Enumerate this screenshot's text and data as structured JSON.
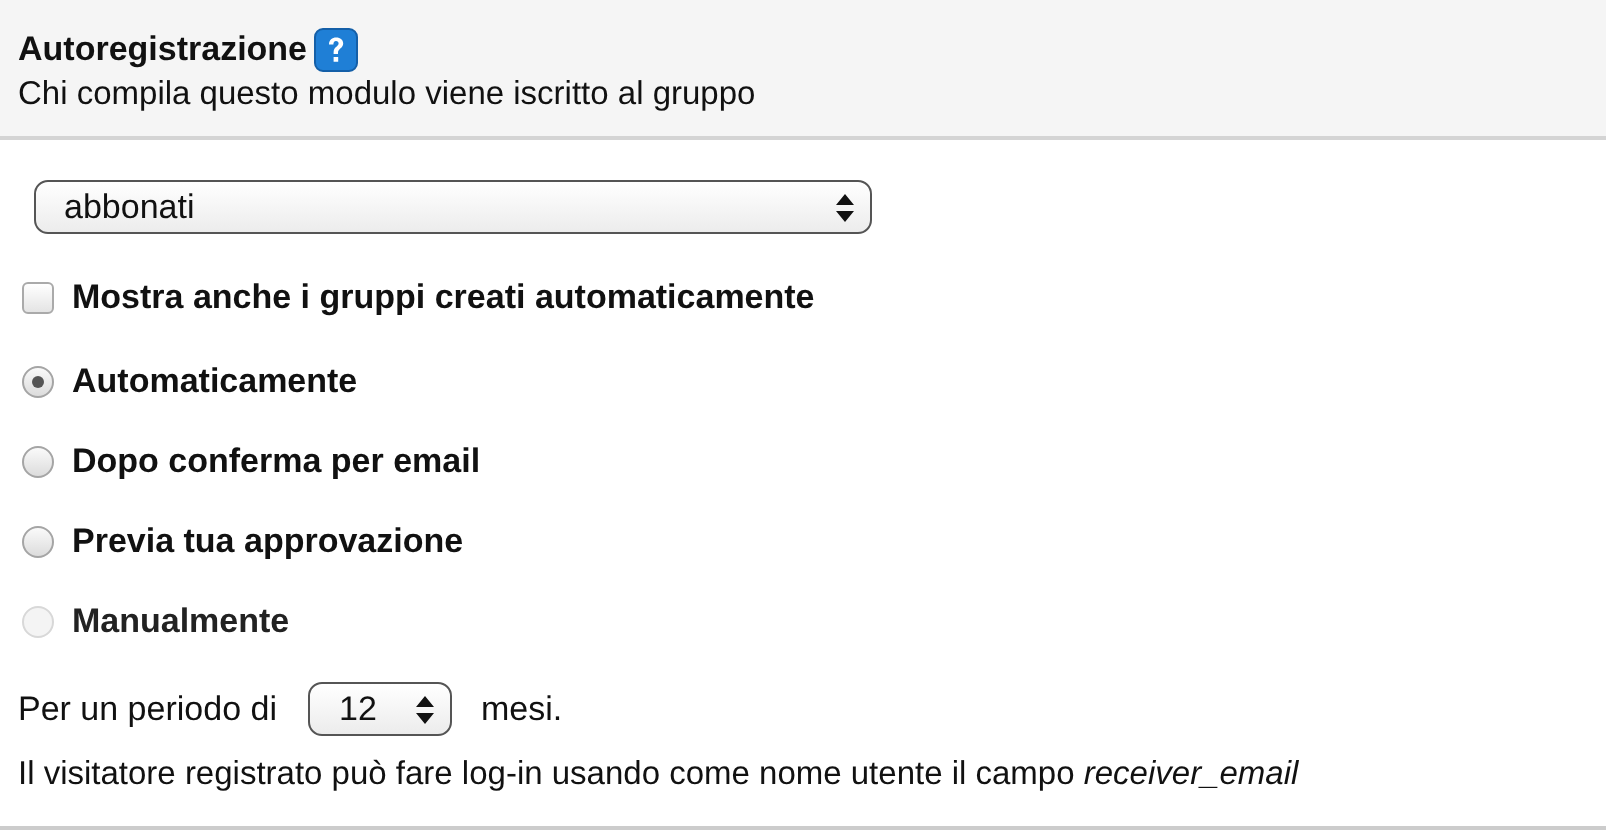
{
  "header": {
    "title": "Autoregistrazione",
    "subtitle": "Chi compila questo modulo viene iscritto al gruppo"
  },
  "group_select": {
    "value": "abbonati"
  },
  "show_auto_groups": {
    "label": "Mostra anche i gruppi creati automaticamente",
    "checked": false
  },
  "modes": [
    {
      "label": "Automaticamente",
      "selected": true,
      "disabled": false
    },
    {
      "label": "Dopo conferma per email",
      "selected": false,
      "disabled": false
    },
    {
      "label": "Previa tua approvazione",
      "selected": false,
      "disabled": false
    },
    {
      "label": "Manualmente",
      "selected": false,
      "disabled": true
    }
  ],
  "period": {
    "prefix": "Per un periodo di",
    "value": "12",
    "suffix": "mesi."
  },
  "note": "Il visitatore registrato può fare log-in usando come nome utente il campo *receiver_email*"
}
